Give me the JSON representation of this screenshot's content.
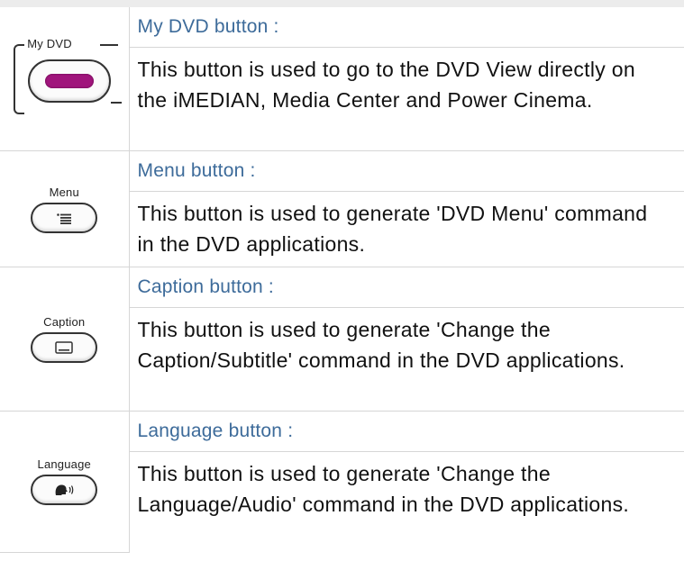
{
  "rows": [
    {
      "remote_label": "My DVD",
      "title": "My DVD button :",
      "description": "This button is used to go to the DVD View directly on the iMEDIAN, Media Center and Power Cinema.",
      "icon": "dvd-pill-icon",
      "accent": "#a0157c"
    },
    {
      "remote_label": "Menu",
      "title": "Menu button :",
      "description": "This button is used to generate 'DVD Menu' command in the DVD applications.",
      "icon": "menu-list-icon"
    },
    {
      "remote_label": "Caption",
      "title": "Caption button :",
      "description": "This button is used to generate 'Change the Caption/Subtitle' command in the DVD applications.",
      "icon": "caption-box-icon"
    },
    {
      "remote_label": "Language",
      "title": "Language button :",
      "description": "This button is used to generate 'Change the Language/Audio' command in the DVD applications.",
      "icon": "speaking-head-icon"
    }
  ],
  "colors": {
    "title": "#3d6b9a",
    "text": "#111111",
    "border": "#d6d6d6",
    "dvd_accent": "#a0157c"
  }
}
